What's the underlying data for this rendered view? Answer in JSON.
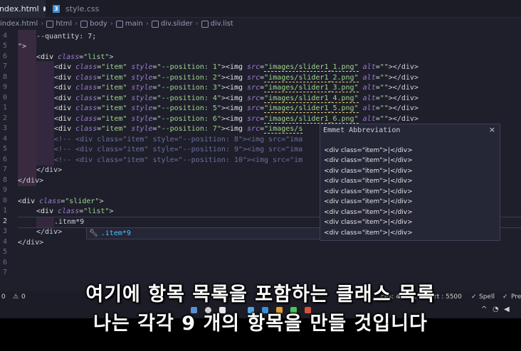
{
  "tabs": [
    {
      "label": "index.html",
      "modified": true,
      "active": true
    },
    {
      "label": "style.css",
      "active": false
    }
  ],
  "breadcrumb": [
    "index.html",
    "html",
    "body",
    "main",
    "div.slider",
    "div.list"
  ],
  "gutter": [
    "4",
    "5",
    "6",
    "7",
    "8",
    "9",
    "0",
    "1",
    "2",
    "3",
    "4",
    "5",
    "6",
    "7",
    "8",
    "9",
    "0",
    "1",
    "2",
    "3",
    "4",
    "5",
    "6",
    "7",
    "8"
  ],
  "code": {
    "l4": "--quantity: 7;",
    "l5": "\">",
    "list_open_tag": "div",
    "list_class_attr": "class",
    "list_class_val": "\"list\"",
    "item_tag": "div",
    "item_class_attr": "class",
    "item_class_val": "\"item\"",
    "style_attr": "style",
    "position_prefix": "\"--position: ",
    "img_tag": "img",
    "src_attr": "src",
    "alt_attr": "alt",
    "items": [
      {
        "pos": "1",
        "src": "images/slider1_1.png"
      },
      {
        "pos": "2",
        "src": "images/slider1_2.png"
      },
      {
        "pos": "3",
        "src": "images/slider1_3.png"
      },
      {
        "pos": "4",
        "src": "images/slider1_4.png"
      },
      {
        "pos": "5",
        "src": "images/slider1_5.png"
      },
      {
        "pos": "6",
        "src": "images/slider1_6.png"
      },
      {
        "pos": "7",
        "src": "images/s"
      }
    ],
    "comments": [
      "<!-- <div class=\"item\" style=\"--position: 8\"><img src=\"ima",
      "<!-- <div class=\"item\" style=\"--position: 9\"><img src=\"ima",
      "<!-- <div class=\"item\" style=\"--position: 10\"><img src=\"im"
    ],
    "list_close": "</div>",
    "div_close": "</div>",
    "slider_class_val": "\"slider\"",
    "typed": ".itnm*9",
    "inner_close": "</div>",
    "outer_close": "</div>"
  },
  "suggest": {
    "icon": "wrench-icon",
    "text": ".item*9"
  },
  "emmet": {
    "title": "Emmet Abbreviation",
    "close": "×",
    "rows": [
      "<div class=\"item\">|</div>",
      "<div class=\"item\">|</div>",
      "<div class=\"item\">|</div>",
      "<div class=\"item\">|</div>",
      "<div class=\"item\">|</div>",
      "<div class=\"item\">|</div>",
      "<div class=\"item\">|</div>",
      "<div class=\"item\">|</div>",
      "<div class=\"item\">|</div>"
    ]
  },
  "status": {
    "left_num": "0",
    "warn_num": "0",
    "middle": "ces: 4",
    "html": "HTML",
    "port": "rt : 5500",
    "spell": "Spell",
    "pre": "Pre"
  },
  "subtitles": {
    "line1": "여기에 항목 목록을 포함하는 클래스 목록",
    "line2": "나는 각각 9 개의 항목을 만들 것입니다"
  }
}
